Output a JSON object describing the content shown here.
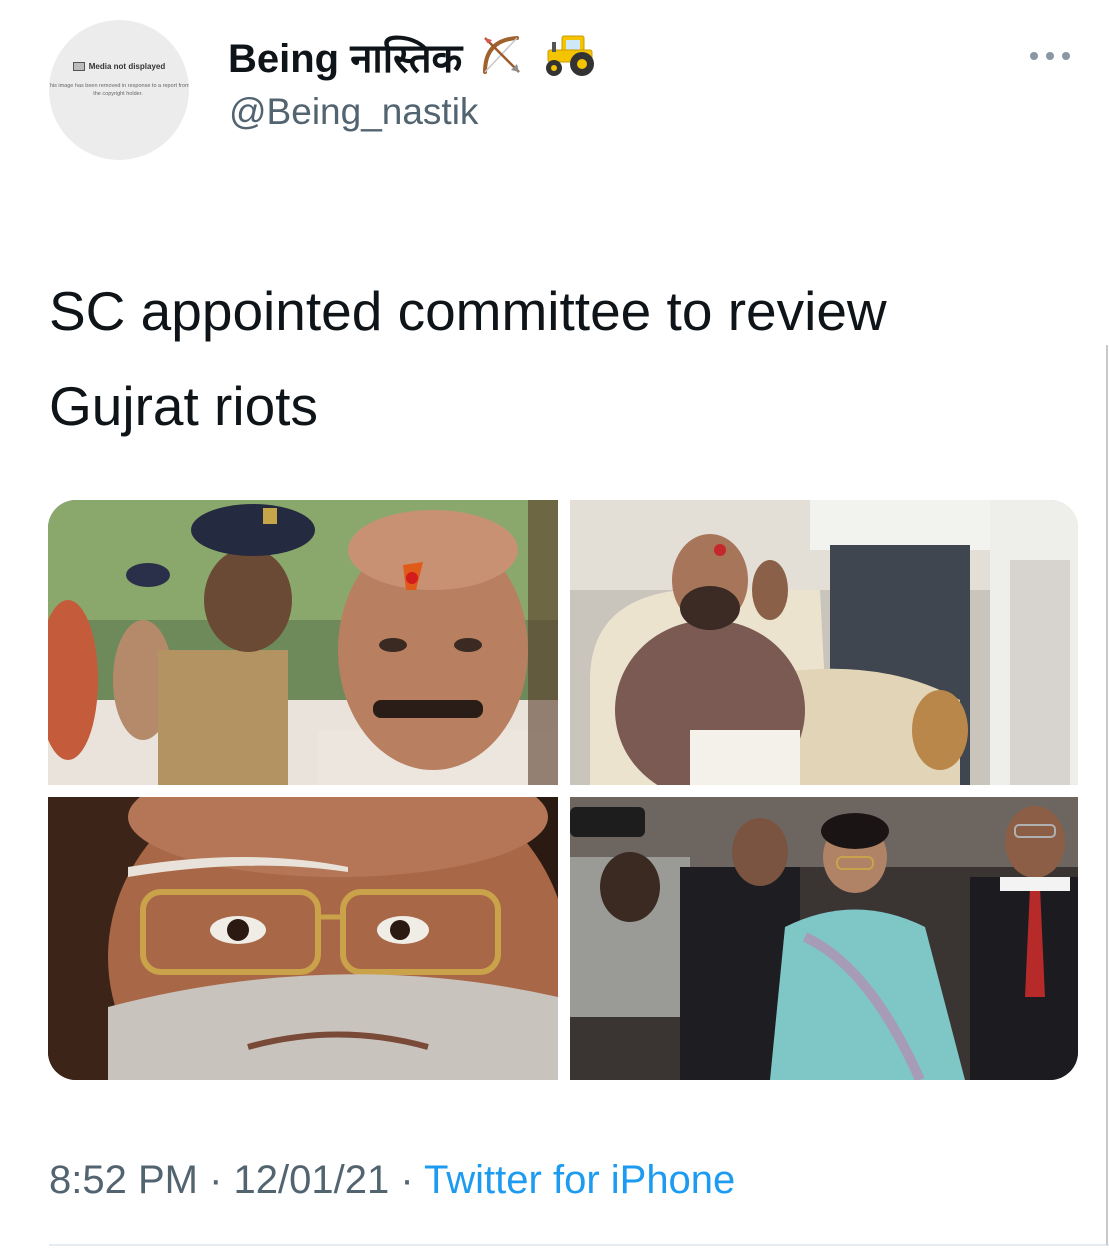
{
  "author": {
    "display_name": "Being नास्तिक",
    "handle": "@Being_nastik",
    "name_emojis": [
      "bow-and-arrow-emoji",
      "tractor-emoji"
    ]
  },
  "avatar": {
    "title": "Media not displayed",
    "note": "This image has been removed in response to a report from the copyright holder."
  },
  "tweet": {
    "line1": "SC appointed committee to review",
    "line2": "Gujrat riots"
  },
  "meta": {
    "time": "8:52 PM",
    "separator": " · ",
    "date": "12/01/21",
    "source": "Twitter for iPhone"
  },
  "colors": {
    "text": "#0f1419",
    "secondary": "#536471",
    "link": "#1d9bf0"
  }
}
